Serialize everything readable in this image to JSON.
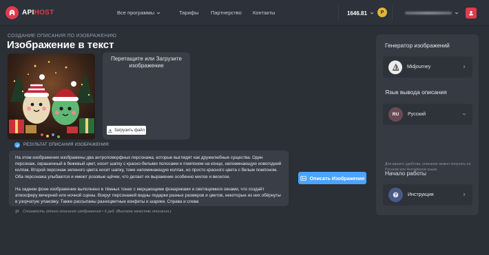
{
  "header": {
    "logo": {
      "brand_a": "API",
      "brand_b": "HOST"
    },
    "nav": [
      {
        "label": "Все программы"
      },
      {
        "label": "Тарифы"
      },
      {
        "label": "Партнерство"
      },
      {
        "label": "Контакты"
      }
    ],
    "balance": "1646.81",
    "coin_label": "P",
    "user_icon": "user-icon"
  },
  "page": {
    "subtitle": "СОЗДАНИЕ ОПИСАНИЯ ПО ИЗОБРАЖЕНИЮ",
    "title": "Изображение в текст"
  },
  "upload": {
    "prompt": "Перетащите или Загрузите изображение",
    "button_label": "Загрузить файл"
  },
  "result": {
    "label": "РЕЗУЛЬТАТ ОПИСАНИЯ ИЗОБРАЖЕНИЯ:",
    "paragraph_1": "На этом изображении изображены два антропоморфных персонажа, которые выглядят как дружелюбные существа. Один персонаж, окрашенный в бежевый цвет, носит шапку с красно-белыми полосами и помпоном на конце, напоминающую новогодний колпак. Второй персонаж зеленого цвета носит шапку, тоже напоминающую колпак, но просто красного цвета с белым помпоном. Оба персонажа улыбаются и имеют розовые щёчки, что делает их выражение особенно милое и веселое.",
    "paragraph_2": "На заднем фоне изображение выполнено в тёмных тонах с мерцающими фонариками и светящимися окнами, что создаёт атмосферу вечерней или ночной сцены. Вокруг персонажей видны подарки разных размеров и цветов, некоторые из них обёрнуты в узорчатую упаковку. Также рассыпаны разноцветные конфеты и шарики. Справа и слева",
    "price_note": "Стоимость одного описания изображения • 6 руб. (Высокое качество описания.)"
  },
  "actions": {
    "describe_label": "Описать Изображение"
  },
  "sidebar": {
    "generator_heading": "Генератор изображений",
    "generator_value": "Midjourney",
    "language_heading": "Язык вывода описания",
    "language_code": "RU",
    "language_value": "Русский",
    "language_note": "Для вашего удобства, описание можно получать на Русском или Английском языке.",
    "start_heading": "Начало работы",
    "start_item": "Инструкция"
  },
  "colors": {
    "accent_red": "#e23a4e",
    "accent_blue": "#4aa3ff",
    "coin_gold": "#e2b53b",
    "background": "#2b2f36"
  }
}
